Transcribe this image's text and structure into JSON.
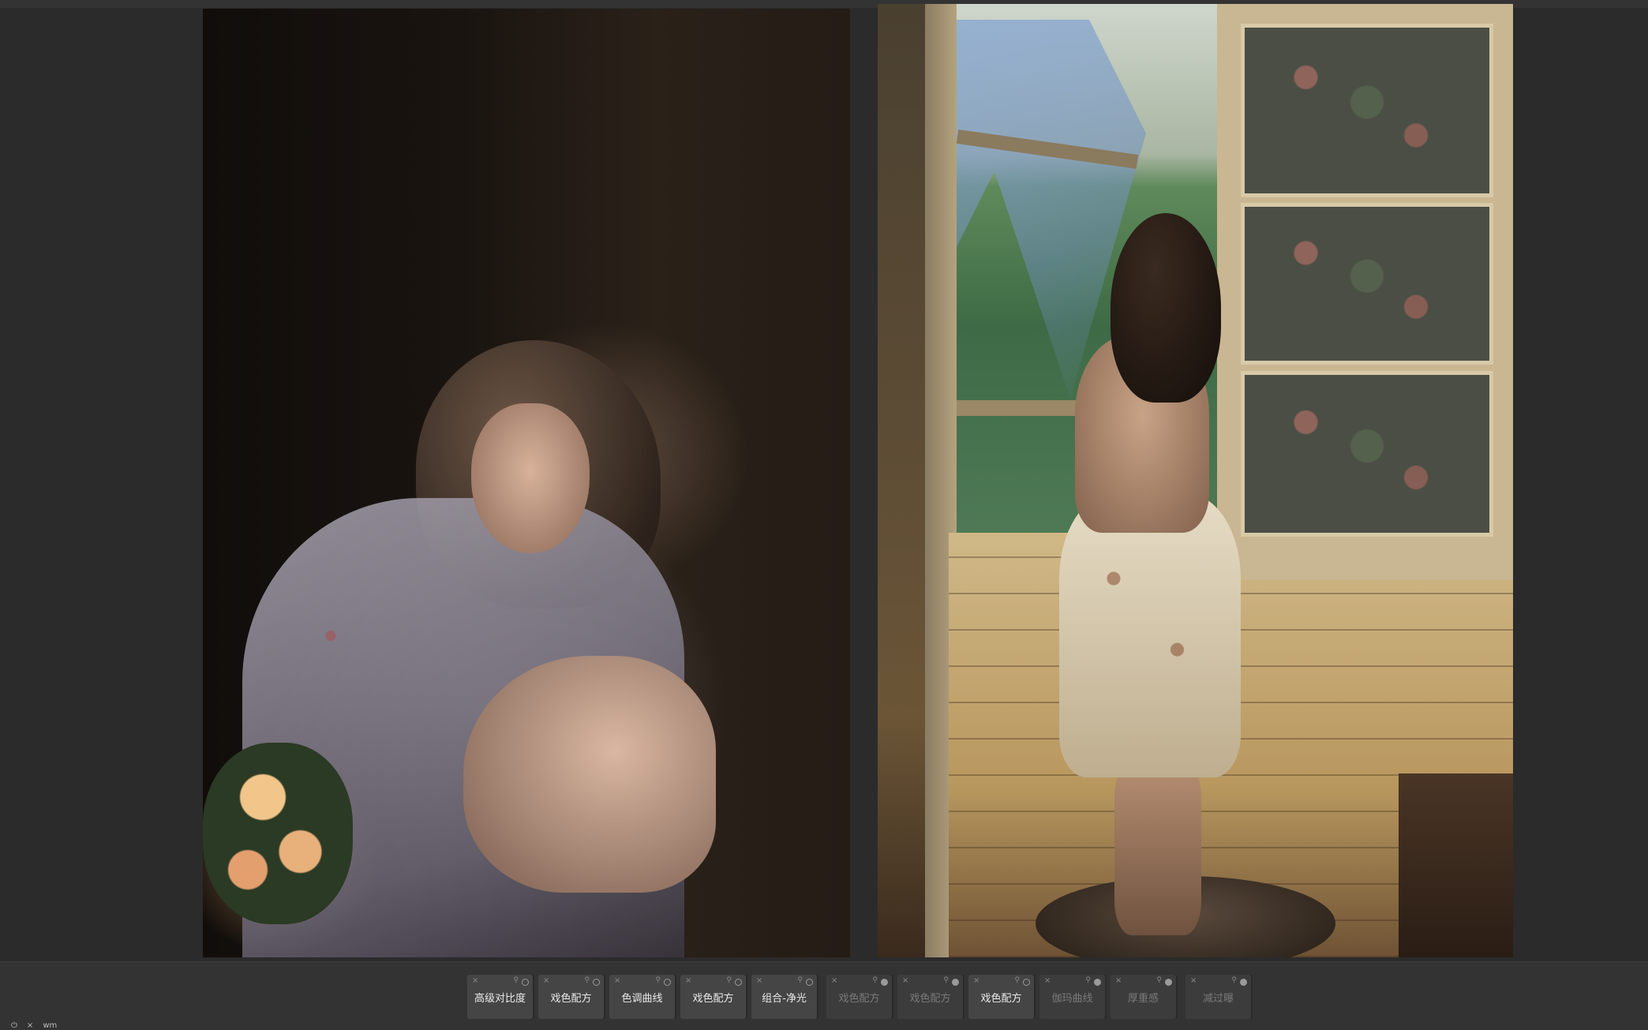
{
  "canvas": {
    "left_photo": "floral-dress-portrait",
    "right_photo": "window-scene-portrait"
  },
  "presets": [
    {
      "label": "高级对比度",
      "active": true
    },
    {
      "label": "戏色配方",
      "active": true
    },
    {
      "label": "色调曲线",
      "active": true
    },
    {
      "label": "戏色配方",
      "active": true
    },
    {
      "label": "组合-净光",
      "active": true
    },
    {
      "label": "戏色配方",
      "active": false
    },
    {
      "label": "戏色配方",
      "active": false
    },
    {
      "label": "戏色配方",
      "active": true
    },
    {
      "label": "伽玛曲线",
      "active": false
    },
    {
      "label": "厚重感",
      "active": false
    },
    {
      "label": "减过曝",
      "active": false
    }
  ],
  "icons": {
    "close": "×",
    "pin": "📌",
    "power": "power-icon"
  },
  "status": {
    "left_label": "wm"
  }
}
